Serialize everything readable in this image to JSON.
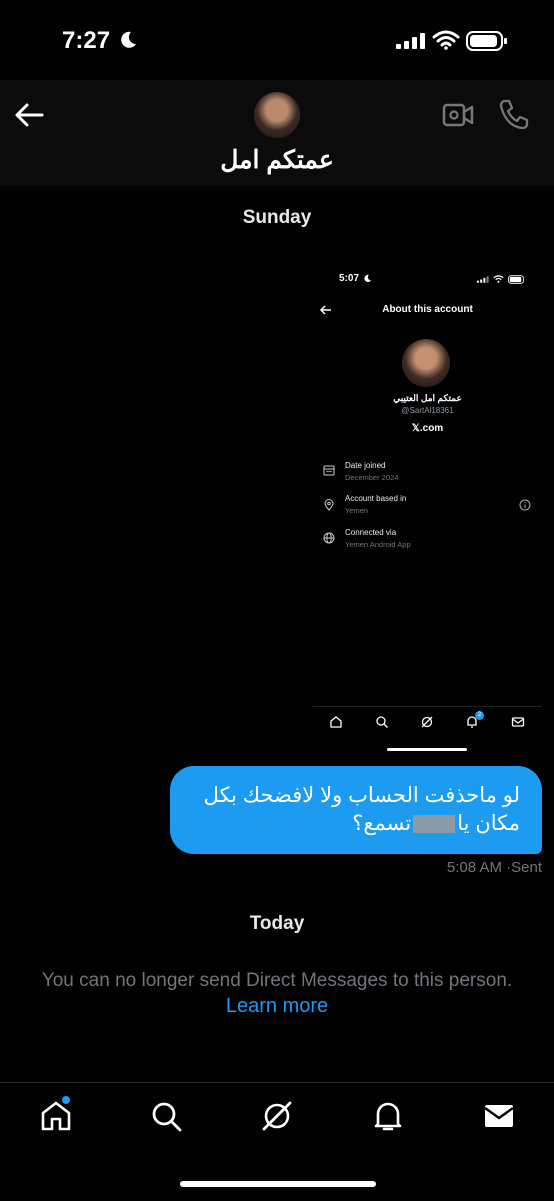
{
  "status_bar": {
    "time": "7:27"
  },
  "header": {
    "contact_name": "عمتكم امل"
  },
  "conversation": {
    "day_1": "Sunday",
    "screenshot": {
      "time": "5:07",
      "title": "About this account",
      "name": "عمتكم امل العتيبي",
      "handle": "@SartAl18361",
      "site": "𝕏.com",
      "rows": [
        {
          "label": "Date joined",
          "value": "December 2024",
          "icon": "calendar-icon"
        },
        {
          "label": "Account based in",
          "value": "Yemen",
          "icon": "location-pin-icon"
        },
        {
          "label": "Connected via",
          "value": "Yemen Android App",
          "icon": "globe-icon"
        }
      ],
      "notification_count": "2"
    },
    "message": {
      "line1": "لو ماحذفت الحساب ولا لافضحك بكل",
      "line2_start": "مكان يا",
      "line2_end": "تسمع؟",
      "time": "5:08 AM",
      "status": "Sent",
      "separator": "·"
    },
    "day_2": "Today",
    "notice": "You can no longer send Direct Messages to this person.",
    "learn_more": "Learn more"
  },
  "colors": {
    "accent": "#1d9bf0",
    "background": "#000000",
    "muted": "#71767b"
  },
  "tabs": [
    "home-icon",
    "search-icon",
    "grok-icon",
    "notifications-icon",
    "messages-icon"
  ]
}
